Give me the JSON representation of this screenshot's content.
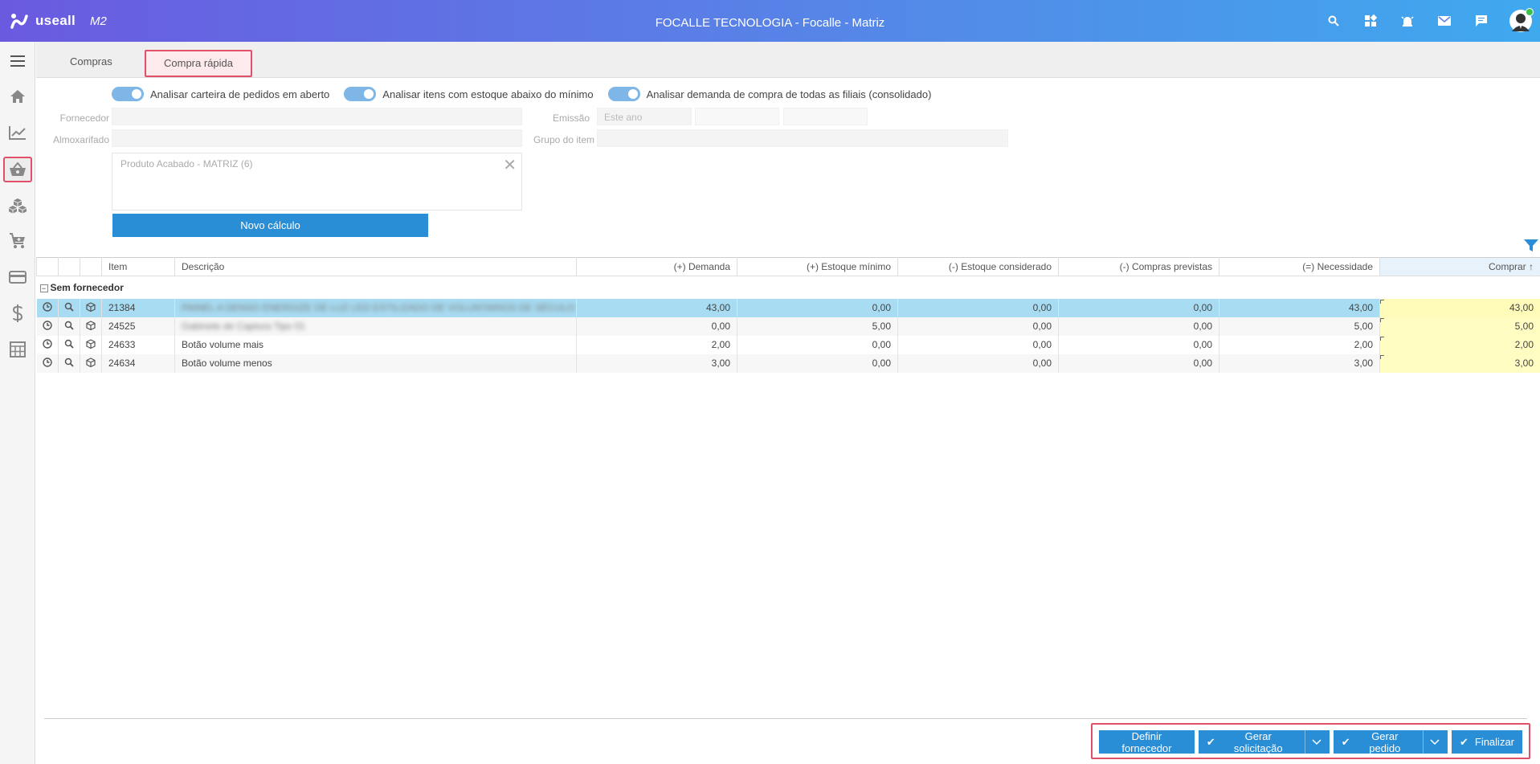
{
  "header": {
    "logo_text": "useall",
    "logo_sub": "M2",
    "title": "FOCALLE TECNOLOGIA - Focalle - Matriz"
  },
  "tabs": [
    {
      "label": "Compras",
      "active": false
    },
    {
      "label": "Compra rápida",
      "active": true
    }
  ],
  "toggles": [
    {
      "label": "Analisar carteira de pedidos em aberto",
      "on": true
    },
    {
      "label": "Analisar itens com estoque abaixo do mínimo",
      "on": true
    },
    {
      "label": "Analisar demanda de compra de todas as filiais (consolidado)",
      "on": true
    }
  ],
  "form": {
    "fornecedor_label": "Fornecedor",
    "almoxarifado_label": "Almoxarifado",
    "emissao_label": "Emissão",
    "emissao_value": "Este ano",
    "grupo_label": "Grupo do item",
    "tag_value": "Produto Acabado - MATRIZ (6)",
    "calc_button": "Novo cálculo"
  },
  "grid": {
    "columns": [
      "Item",
      "Descrição",
      "(+) Demanda",
      "(+) Estoque mínimo",
      "(-) Estoque considerado",
      "(-) Compras previstas",
      "(=) Necessidade",
      "Comprar ↑"
    ],
    "group_label": "Sem fornecedor",
    "rows": [
      {
        "item": "21384",
        "desc": "PAINEL A DENSO ENERGIZE DE LUZ LED ESTILIZADO DE VOLUNTARIOS DE SÉCULO XX",
        "demanda": "43,00",
        "est_min": "0,00",
        "est_cons": "0,00",
        "compras": "0,00",
        "necess": "43,00",
        "comprar": "43,00",
        "blur": true
      },
      {
        "item": "24525",
        "desc": "Gabinete de Captura Tipo 01",
        "demanda": "0,00",
        "est_min": "5,00",
        "est_cons": "0,00",
        "compras": "0,00",
        "necess": "5,00",
        "comprar": "5,00",
        "blur": true
      },
      {
        "item": "24633",
        "desc": "Botão volume mais",
        "demanda": "2,00",
        "est_min": "0,00",
        "est_cons": "0,00",
        "compras": "0,00",
        "necess": "2,00",
        "comprar": "2,00",
        "blur": false
      },
      {
        "item": "24634",
        "desc": "Botão volume menos",
        "demanda": "3,00",
        "est_min": "0,00",
        "est_cons": "0,00",
        "compras": "0,00",
        "necess": "3,00",
        "comprar": "3,00",
        "blur": false
      }
    ]
  },
  "actions": {
    "definir": "Definir fornecedor",
    "solicitacao": "Gerar solicitação",
    "pedido": "Gerar pedido",
    "finalizar": "Finalizar"
  },
  "colors": {
    "accent": "#2a8ed6",
    "highlight": "#e05068",
    "selected_row": "#a8dcf2",
    "buy_cell": "#fffdc2"
  }
}
